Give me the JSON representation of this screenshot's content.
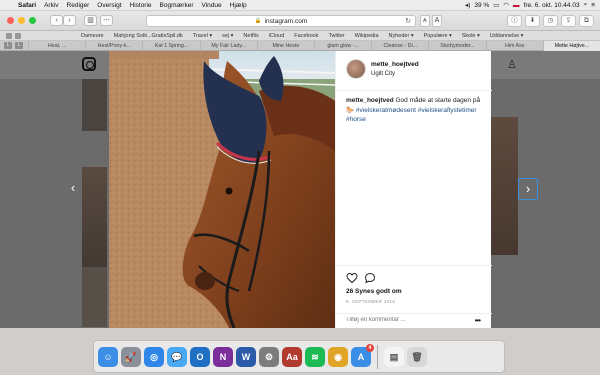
{
  "menubar": {
    "app_name": "Safari",
    "items": [
      "Arkiv",
      "Rediger",
      "Oversigt",
      "Historie",
      "Bogmærker",
      "Vindue",
      "Hjælp"
    ],
    "battery": "39 %",
    "clock": "fre. 6. okt.  10.44.03"
  },
  "toolbar": {
    "url": "instagram.com",
    "text_size": [
      "A",
      "A"
    ]
  },
  "favorites": [
    "Dameure",
    "Mahjong Solit...GratisSpil.dk",
    "Travel ▾",
    "sej ▾",
    "Netflix",
    "iCloud",
    "Facebook",
    "Twitter",
    "Wikipedia",
    "Nyheder ▾",
    "Populære ▾",
    "Skole ▾",
    "Uddannelse ▾"
  ],
  "tabs": [
    "Heat, ...",
    "Hest/Pony-k...",
    "Kat 1 Spring...",
    "My Fair Lady...",
    "Mine Heste",
    "glam glow -...",
    "Cleanse - Di...",
    "Storbymoder...",
    "Him Ass",
    "Mette Højtve..."
  ],
  "active_tab_index": 9,
  "post": {
    "username": "mette_hoejtved",
    "location": "Ugilt City",
    "caption_user": "mette_hoejtved",
    "caption_text": "God måde at starte dagen på 🐎",
    "hashtags": [
      "#vielskeratmødesent",
      "#vielskeraflystetimer",
      "#horse"
    ],
    "likes": "26 Synes godt om",
    "date": "9. SEPTEMBER 2016",
    "comment_placeholder": "Tilføj en kommentar ...",
    "more": "•••"
  },
  "dock": {
    "apps": [
      {
        "name": "finder",
        "color": "#3a8ee6",
        "glyph": "☺"
      },
      {
        "name": "launchpad",
        "color": "#8a8f99",
        "glyph": "🚀"
      },
      {
        "name": "safari",
        "color": "#2f86e8",
        "glyph": "◎"
      },
      {
        "name": "messages",
        "color": "#4aa9f5",
        "glyph": "💬"
      },
      {
        "name": "outlook",
        "color": "#1f6fc3",
        "glyph": "O"
      },
      {
        "name": "onenote",
        "color": "#7b2d9b",
        "glyph": "N"
      },
      {
        "name": "word",
        "color": "#2b5aa8",
        "glyph": "W"
      },
      {
        "name": "system-preferences",
        "color": "#7d7d7d",
        "glyph": "⚙"
      },
      {
        "name": "dictionary",
        "color": "#b03a2e",
        "glyph": "Aa"
      },
      {
        "name": "spotify",
        "color": "#1db954",
        "glyph": "≋"
      },
      {
        "name": "chrome",
        "color": "#e0a526",
        "glyph": "◉"
      },
      {
        "name": "app-store",
        "color": "#3a8ee6",
        "glyph": "A",
        "badge": "4"
      },
      {
        "name": "documents",
        "color": "#f4f4f4",
        "glyph": "▤"
      },
      {
        "name": "trash",
        "color": "#d8d8d8",
        "glyph": "🗑"
      }
    ]
  }
}
